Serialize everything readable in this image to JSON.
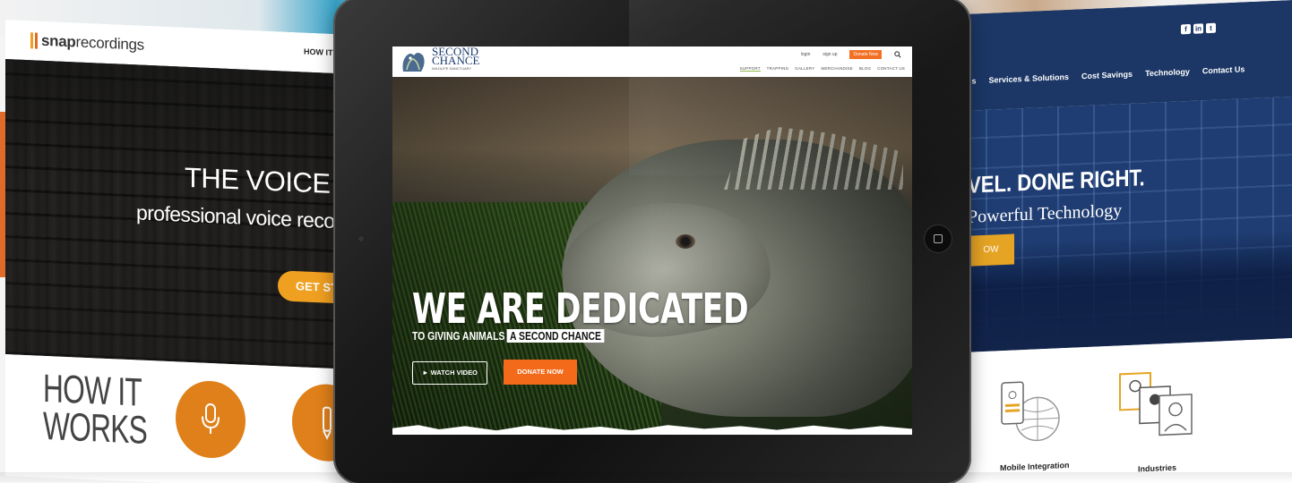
{
  "left_site": {
    "logo_brand_a": "snap",
    "logo_brand_b": "recordings",
    "nav_item": "HOW IT W",
    "hero_title": "THE VOICE OF YO",
    "hero_subtitle": "professional voice recording",
    "cta_label": "GET STAR",
    "section_title_line1": "HOW IT",
    "section_title_line2": "WORKS",
    "accent_color": "#e0801a"
  },
  "right_site": {
    "social_icons": [
      "facebook-icon",
      "linkedin-icon",
      "twitter-icon"
    ],
    "nav_items": [
      "Us",
      "Services & Solutions",
      "Cost Savings",
      "Technology",
      "Contact Us"
    ],
    "hero_title": "VEL. DONE RIGHT.",
    "hero_subtitle": "Powerful Technology",
    "cta_label": "OW",
    "features": [
      "Mobile Integration",
      "Industries"
    ],
    "brand_color": "#1c3766",
    "accent_color": "#e6a424"
  },
  "tablet_site": {
    "logo_line1": "SECOND",
    "logo_line2": "CHANCE",
    "logo_tagline": "WILDLIFE SANCTUARY",
    "top_links": [
      "login",
      "sign up"
    ],
    "donate_label": "Donate Now",
    "nav_items": [
      "SUPPORT",
      "TRAPPING",
      "GALLERY",
      "MERCHANDISE",
      "BLOG",
      "CONTACT US"
    ],
    "active_nav": "SUPPORT",
    "hero_title": "WE ARE DEDICATED",
    "hero_line_a": "TO GIVING ANIMALS",
    "hero_line_b": "A SECOND CHANCE",
    "watch_video_label": "► WATCH VIDEO",
    "donate_now_label": "DONATE NOW",
    "accent_color": "#f26a1a"
  }
}
